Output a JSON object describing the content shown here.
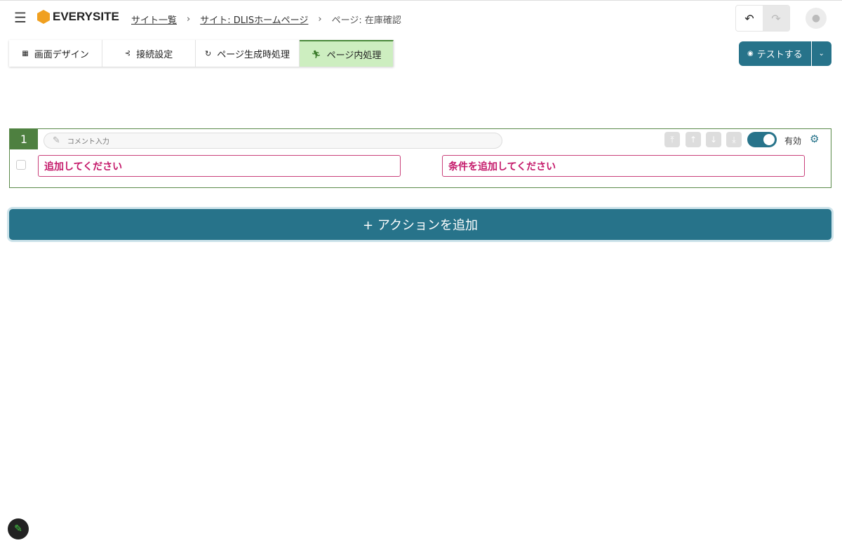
{
  "header": {
    "logo": "EVERYSITE",
    "breadcrumbs": [
      "サイト一覧",
      "サイト: DLISホームページ"
    ],
    "current": "ページ: 在庫確認"
  },
  "tabs": [
    {
      "label": "画面デザイン"
    },
    {
      "label": "接続設定"
    },
    {
      "label": "ページ生成時処理"
    },
    {
      "label": "ページ内処理"
    }
  ],
  "test_button": "テストする",
  "action": {
    "number": "1",
    "comment_placeholder": "コメント入力",
    "action_field": "追加してください",
    "condition_field": "条件を追加してください",
    "enabled_label": "有効"
  },
  "add_action": "+ アクションを追加",
  "colors": {
    "accent": "#27738a",
    "active_tab": "#cdeec0",
    "error": "#c4196a"
  }
}
